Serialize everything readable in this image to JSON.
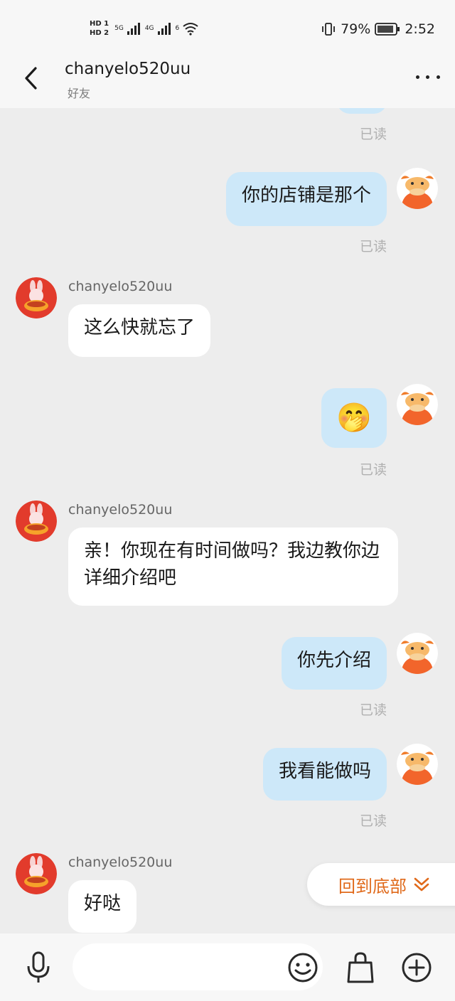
{
  "status_bar": {
    "hd1": "HD 1",
    "hd2": "HD 2",
    "net1": "5G",
    "net2": "4G",
    "wifi_label": "6",
    "battery": "79%",
    "time": "2:52"
  },
  "header": {
    "title": "chanyelo520uu",
    "subtitle": "好友"
  },
  "messages": [
    {
      "text": "你的店铺是那个",
      "read": "已读"
    },
    {
      "sender": "chanyelo520uu",
      "text": "这么快就忘了"
    },
    {
      "emoji": "🤭",
      "read": "已读"
    },
    {
      "sender": "chanyelo520uu",
      "text": "亲！你现在有时间做吗？我边教你边详细介绍吧"
    },
    {
      "text": "你先介绍",
      "read": "已读"
    },
    {
      "text": "我看能做吗",
      "read": "已读"
    },
    {
      "sender": "chanyelo520uu",
      "text": "好哒"
    }
  ],
  "top_partial_read": "已读",
  "back_to_bottom": "回到底部",
  "input": {
    "placeholder": ""
  },
  "colors": {
    "accent": "#e06a1b",
    "out_bubble": "#cde8f9",
    "in_bubble": "#ffffff",
    "background": "#ededed"
  },
  "icons": [
    "back-icon",
    "more-icon",
    "mic-icon",
    "emoji-icon",
    "shopping-bag-icon",
    "plus-icon",
    "chevron-down-icon"
  ]
}
